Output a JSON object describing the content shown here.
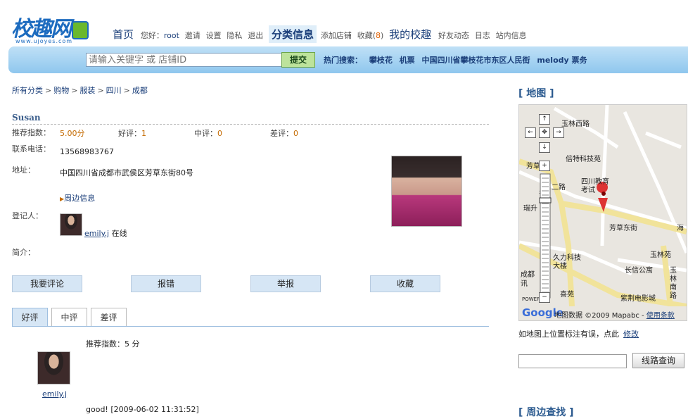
{
  "logo": {
    "text": "校趣网",
    "sub": "www.ujoyes.com"
  },
  "nav": {
    "home": "首页",
    "greeting": "您好：",
    "user": "root",
    "invite": "邀请",
    "settings": "设置",
    "privacy": "隐私",
    "logout": "退出",
    "classified": "分类信息",
    "add_shop": "添加店铺",
    "favorites": "收藏(",
    "favorites_count": "8",
    "favorites_close": ")",
    "my_school": "我的校趣",
    "friend_activity": "好友动态",
    "log": "日志",
    "site_messages": "站内信息"
  },
  "search": {
    "placeholder": "请输入关键字 或 店铺ID",
    "submit": "提交",
    "hot_label": "热门搜索：",
    "hot_terms": [
      "攀枝花",
      "机票",
      "中国四川省攀枝花市东区人民街",
      "melody 票务"
    ]
  },
  "breadcrumb": [
    "所有分类",
    "购物",
    "服装",
    "四川",
    "成都"
  ],
  "listing": {
    "name": "Susan",
    "rating_label": "推荐指数：",
    "rating_value": "5.00分",
    "good_label": "好评：",
    "good_count": "1",
    "mid_label": "中评：",
    "mid_count": "0",
    "bad_label": "差评：",
    "bad_count": "0",
    "phone_label": "联系电话：",
    "phone": "13568983767",
    "address_label": "地址：",
    "address": "中国四川省成都市武侯区芳草东街80号",
    "nearby": "周边信息",
    "registrant_label": "登记人：",
    "registrant": "emily.j",
    "online": "在线",
    "intro_label": "简介："
  },
  "actions": [
    "我要评论",
    "报错",
    "举报",
    "收藏"
  ],
  "tabs": [
    "好评",
    "中评",
    "差评"
  ],
  "review": {
    "rating": "推荐指数：5 分",
    "user": "emily.j",
    "text": "good!",
    "time": "[2009-06-02 11:31:52]"
  },
  "map": {
    "title": "[ 地图 ]",
    "labels": [
      "玉林西路",
      "倍特科技苑",
      "芳草街",
      "二路",
      "四川教育",
      "考试",
      "名",
      "瑞升",
      "芳草东街",
      "海",
      "玉林苑",
      "久力科技",
      "大楼",
      "长信公寓",
      "成都",
      "讯",
      "喜苑",
      "紫荆电影城",
      "玉",
      "林",
      "南",
      "路",
      "POWER"
    ],
    "google": "Google",
    "data_label": "地图数据 ©2009 Mapabc -",
    "terms": "使用条款",
    "note": "如地图上位置标注有误，点此",
    "modify": "修改",
    "route_btn": "线路查询",
    "nearby_title": "[ 周边查找 ]"
  },
  "colors": {
    "accent": "#1b3f7a",
    "bar": "#8fc7ee",
    "count": "#c46a00"
  }
}
